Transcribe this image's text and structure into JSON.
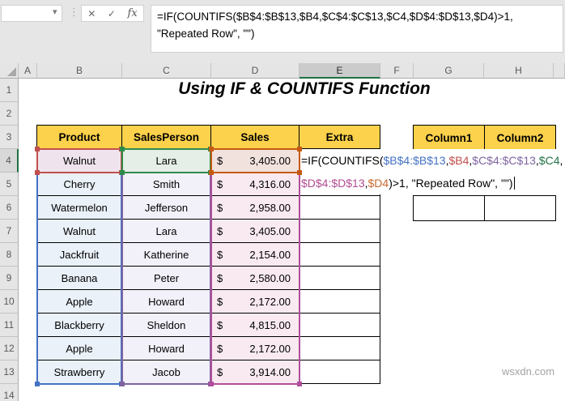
{
  "formula_bar": {
    "name_box_value": "",
    "cancel_icon": "✕",
    "enter_icon": "✓",
    "fx_icon": "fx",
    "line1": "=IF(COUNTIFS($B$4:$B$13,$B4,$C$4:$C$13,$C4,$D$4:$D$13,$D4)>1,",
    "line2": "\"Repeated Row\", \"\")"
  },
  "grid": {
    "column_headers": [
      "A",
      "B",
      "C",
      "D",
      "E",
      "F",
      "G",
      "H"
    ],
    "row_headers": [
      "1",
      "2",
      "3",
      "4",
      "5",
      "6",
      "7",
      "8",
      "9",
      "10",
      "11",
      "12",
      "13",
      "14"
    ],
    "active_column": "E",
    "active_row": "4"
  },
  "sheet": {
    "title": "Using IF & COUNTIFS Function"
  },
  "table": {
    "currency": "$",
    "headers": [
      "Product",
      "SalesPerson",
      "Sales",
      "Extra"
    ],
    "rows": [
      {
        "product": "Walnut",
        "salesperson": "Lara",
        "sales": "3,405.00"
      },
      {
        "product": "Cherry",
        "salesperson": "Smith",
        "sales": "4,316.00"
      },
      {
        "product": "Watermelon",
        "salesperson": "Jefferson",
        "sales": "2,958.00"
      },
      {
        "product": "Walnut",
        "salesperson": "Lara",
        "sales": "3,405.00"
      },
      {
        "product": "Jackfruit",
        "salesperson": "Katherine",
        "sales": "2,154.00"
      },
      {
        "product": "Banana",
        "salesperson": "Peter",
        "sales": "2,580.00"
      },
      {
        "product": "Apple",
        "salesperson": "Howard",
        "sales": "2,172.00"
      },
      {
        "product": "Blackberry",
        "salesperson": "Sheldon",
        "sales": "4,815.00"
      },
      {
        "product": "Apple",
        "salesperson": "Howard",
        "sales": "2,172.00"
      },
      {
        "product": "Strawberry",
        "salesperson": "Jacob",
        "sales": "3,914.00"
      }
    ]
  },
  "right_table": {
    "headers": [
      "Column1",
      "Column2"
    ]
  },
  "cell_formula": {
    "prefix": "=IF(COUNTIFS(",
    "b_range": "$B$4:$B$13",
    "comma": ",",
    "b_cell": "$B4",
    "c_range": "$C$4:$C$13",
    "c_cell": "$C4",
    "d_range": "$D$4:$D$13",
    "d_cell": "$D4",
    "suffix": ")>1, \"Repeated Row\", \"\")"
  },
  "colors": {
    "header_fill": "#FCD14B",
    "ref_blue": "#4472C4",
    "ref_red": "#C0504D",
    "ref_purple": "#8064A2",
    "ref_green": "#217346",
    "ref_magenta": "#B34C93",
    "ref_orange": "#C96A30",
    "active_accent_green": "#1E7145"
  },
  "watermark": "wsxdn.com"
}
